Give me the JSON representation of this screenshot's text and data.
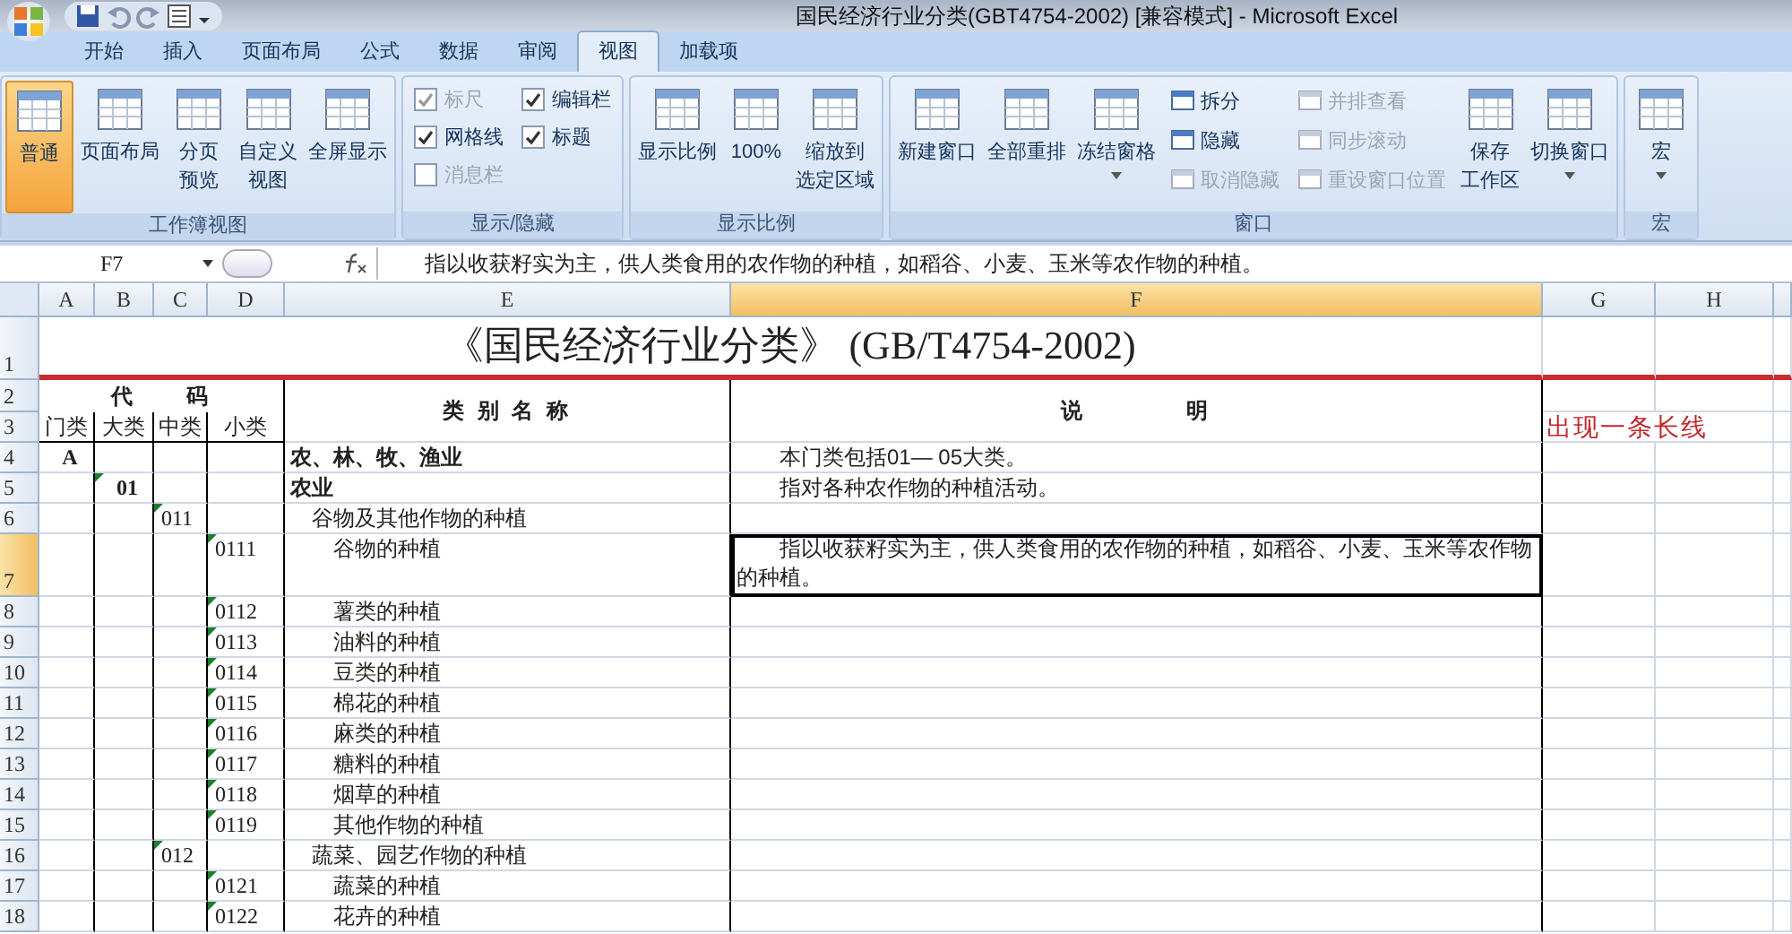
{
  "window": {
    "title": "国民经济行业分类(GBT4754-2002)  [兼容模式] - Microsoft Excel"
  },
  "tabs": [
    {
      "label": "开始",
      "selected": false
    },
    {
      "label": "插入",
      "selected": false
    },
    {
      "label": "页面布局",
      "selected": false
    },
    {
      "label": "公式",
      "selected": false
    },
    {
      "label": "数据",
      "selected": false
    },
    {
      "label": "审阅",
      "selected": false
    },
    {
      "label": "视图",
      "selected": true
    },
    {
      "label": "加载项",
      "selected": false
    }
  ],
  "ribbon": {
    "groups": [
      {
        "title": "工作簿视图",
        "items": [
          {
            "kind": "large",
            "label": "普通",
            "selected": true
          },
          {
            "kind": "large",
            "label": "页面布局",
            "selected": false
          },
          {
            "kind": "large",
            "lines": [
              "分页",
              "预览"
            ],
            "selected": false
          },
          {
            "kind": "large",
            "lines": [
              "自定义",
              "视图"
            ],
            "selected": false
          },
          {
            "kind": "large",
            "label": "全屏显示",
            "selected": false
          }
        ]
      },
      {
        "title": "显示/隐藏",
        "items": [
          {
            "kind": "stack",
            "items": [
              {
                "kind": "check",
                "label": "标尺",
                "checked": true,
                "disabled": true
              },
              {
                "kind": "check",
                "label": "网格线",
                "checked": true,
                "disabled": false
              },
              {
                "kind": "check",
                "label": "消息栏",
                "checked": false,
                "disabled": true
              }
            ]
          },
          {
            "kind": "stack",
            "items": [
              {
                "kind": "check",
                "label": "编辑栏",
                "checked": true,
                "disabled": false
              },
              {
                "kind": "check",
                "label": "标题",
                "checked": true,
                "disabled": false
              }
            ]
          }
        ]
      },
      {
        "title": "显示比例",
        "items": [
          {
            "kind": "large",
            "label": "显示比例",
            "selected": false
          },
          {
            "kind": "large",
            "label": "100%",
            "selected": false
          },
          {
            "kind": "large",
            "lines": [
              "缩放到",
              "选定区域"
            ],
            "selected": false
          }
        ]
      },
      {
        "title": "窗口",
        "items": [
          {
            "kind": "large",
            "label": "新建窗口",
            "selected": false
          },
          {
            "kind": "large",
            "label": "全部重排",
            "selected": false
          },
          {
            "kind": "large",
            "label": "冻结窗格",
            "selected": false,
            "dropdown": true
          },
          {
            "kind": "stack",
            "items": [
              {
                "kind": "small",
                "label": "拆分",
                "disabled": false
              },
              {
                "kind": "small",
                "label": "隐藏",
                "disabled": false
              },
              {
                "kind": "small",
                "label": "取消隐藏",
                "disabled": true
              }
            ]
          },
          {
            "kind": "stack",
            "items": [
              {
                "kind": "small",
                "label": "并排查看",
                "disabled": true
              },
              {
                "kind": "small",
                "label": "同步滚动",
                "disabled": true
              },
              {
                "kind": "small",
                "label": "重设窗口位置",
                "disabled": true
              }
            ]
          },
          {
            "kind": "large",
            "lines": [
              "保存",
              "工作区"
            ],
            "selected": false
          },
          {
            "kind": "large",
            "label": "切换窗口",
            "selected": false,
            "dropdown": true
          }
        ]
      },
      {
        "title": "宏",
        "items": [
          {
            "kind": "large",
            "label": "宏",
            "selected": false,
            "dropdown": true
          }
        ]
      }
    ]
  },
  "formula_bar": {
    "name_box": "F7",
    "content": "　　指以收获籽实为主，供人类食用的农作物的种植，如稻谷、小麦、玉米等农作物的种植。"
  },
  "sheet": {
    "columns": [
      {
        "letter": "A",
        "selected": false
      },
      {
        "letter": "B",
        "selected": false
      },
      {
        "letter": "C",
        "selected": false
      },
      {
        "letter": "D",
        "selected": false
      },
      {
        "letter": "E",
        "selected": false
      },
      {
        "letter": "F",
        "selected": true
      },
      {
        "letter": "G",
        "selected": false
      },
      {
        "letter": "H",
        "selected": false
      }
    ],
    "rows": [
      {
        "number": "1",
        "selected": false,
        "cells": [
          null,
          null,
          null,
          null,
          null,
          {
            "kind": "title",
            "text": "《国民经济行业分类》 (GB/T4754-2002)"
          },
          null,
          null
        ]
      },
      {
        "number": "2",
        "selected": false,
        "cells": [
          null,
          {
            "kind": "group_header",
            "text": "代　　码"
          },
          null,
          null,
          {
            "kind": "column_header",
            "text": "类 别 名 称"
          },
          {
            "kind": "column_header",
            "text": "说　　　　明"
          },
          null,
          null
        ]
      },
      {
        "number": "3",
        "selected": false,
        "cells": [
          {
            "kind": "header",
            "text": "门类"
          },
          {
            "kind": "header",
            "text": "大类"
          },
          {
            "kind": "header",
            "text": "中类"
          },
          {
            "kind": "header",
            "text": "小类"
          },
          null,
          null,
          null,
          null
        ]
      },
      {
        "number": "4",
        "selected": false,
        "cells": [
          {
            "kind": "code",
            "text": "A",
            "bold": true
          },
          null,
          null,
          null,
          {
            "kind": "text",
            "text": "农、林、牧、渔业",
            "bold": true
          },
          {
            "kind": "text",
            "text": "　　本门类包括01— 05大类。"
          },
          null,
          null
        ]
      },
      {
        "number": "5",
        "selected": false,
        "cells": [
          null,
          {
            "kind": "code",
            "text": "01",
            "bold": true,
            "flagged": true
          },
          null,
          null,
          {
            "kind": "text",
            "text": "农业",
            "bold": true
          },
          {
            "kind": "text",
            "text": "　　指对各种农作物的种植活动。"
          },
          null,
          null
        ]
      },
      {
        "number": "6",
        "selected": false,
        "cells": [
          null,
          null,
          {
            "kind": "code",
            "text": "011",
            "flagged": true
          },
          null,
          {
            "kind": "text",
            "text": "　谷物及其他作物的种植"
          },
          null,
          null,
          null
        ]
      },
      {
        "number": "7",
        "selected": true,
        "cells": [
          null,
          null,
          null,
          {
            "kind": "code",
            "text": "0111",
            "flagged": true
          },
          {
            "kind": "text",
            "text": "　　谷物的种植"
          },
          {
            "kind": "text",
            "text": "　　指以收获籽实为主，供人类食用的农作物的种植，如稻谷、小麦、玉米等农作物的种植。"
          },
          null,
          null
        ]
      },
      {
        "number": "8",
        "selected": false,
        "cells": [
          null,
          null,
          null,
          {
            "kind": "code",
            "text": "0112",
            "flagged": true
          },
          {
            "kind": "text",
            "text": "　　薯类的种植"
          },
          null,
          null,
          null
        ]
      },
      {
        "number": "9",
        "selected": false,
        "cells": [
          null,
          null,
          null,
          {
            "kind": "code",
            "text": "0113",
            "flagged": true
          },
          {
            "kind": "text",
            "text": "　　油料的种植"
          },
          null,
          null,
          null
        ]
      },
      {
        "number": "10",
        "selected": false,
        "cells": [
          null,
          null,
          null,
          {
            "kind": "code",
            "text": "0114",
            "flagged": true
          },
          {
            "kind": "text",
            "text": "　　豆类的种植"
          },
          null,
          null,
          null
        ]
      },
      {
        "number": "11",
        "selected": false,
        "cells": [
          null,
          null,
          null,
          {
            "kind": "code",
            "text": "0115",
            "flagged": true
          },
          {
            "kind": "text",
            "text": "　　棉花的种植"
          },
          null,
          null,
          null
        ]
      },
      {
        "number": "12",
        "selected": false,
        "cells": [
          null,
          null,
          null,
          {
            "kind": "code",
            "text": "0116",
            "flagged": true
          },
          {
            "kind": "text",
            "text": "　　麻类的种植"
          },
          null,
          null,
          null
        ]
      },
      {
        "number": "13",
        "selected": false,
        "cells": [
          null,
          null,
          null,
          {
            "kind": "code",
            "text": "0117",
            "flagged": true
          },
          {
            "kind": "text",
            "text": "　　糖料的种植"
          },
          null,
          null,
          null
        ]
      },
      {
        "number": "14",
        "selected": false,
        "cells": [
          null,
          null,
          null,
          {
            "kind": "code",
            "text": "0118",
            "flagged": true
          },
          {
            "kind": "text",
            "text": "　　烟草的种植"
          },
          null,
          null,
          null
        ]
      },
      {
        "number": "15",
        "selected": false,
        "cells": [
          null,
          null,
          null,
          {
            "kind": "code",
            "text": "0119",
            "flagged": true
          },
          {
            "kind": "text",
            "text": "　　其他作物的种植"
          },
          null,
          null,
          null
        ]
      },
      {
        "number": "16",
        "selected": false,
        "cells": [
          null,
          null,
          {
            "kind": "code",
            "text": "012",
            "flagged": true
          },
          null,
          {
            "kind": "text",
            "text": "　蔬菜、园艺作物的种植"
          },
          null,
          null,
          null
        ]
      },
      {
        "number": "17",
        "selected": false,
        "cells": [
          null,
          null,
          null,
          {
            "kind": "code",
            "text": "0121",
            "flagged": true
          },
          {
            "kind": "text",
            "text": "　　蔬菜的种植"
          },
          null,
          null,
          null
        ]
      },
      {
        "number": "18",
        "selected": false,
        "cells": [
          null,
          null,
          null,
          {
            "kind": "code",
            "text": "0122",
            "flagged": true
          },
          {
            "kind": "text",
            "text": "　　花卉的种植"
          },
          null,
          null,
          null
        ]
      }
    ]
  },
  "annotation": {
    "text": "出现一条长线"
  }
}
